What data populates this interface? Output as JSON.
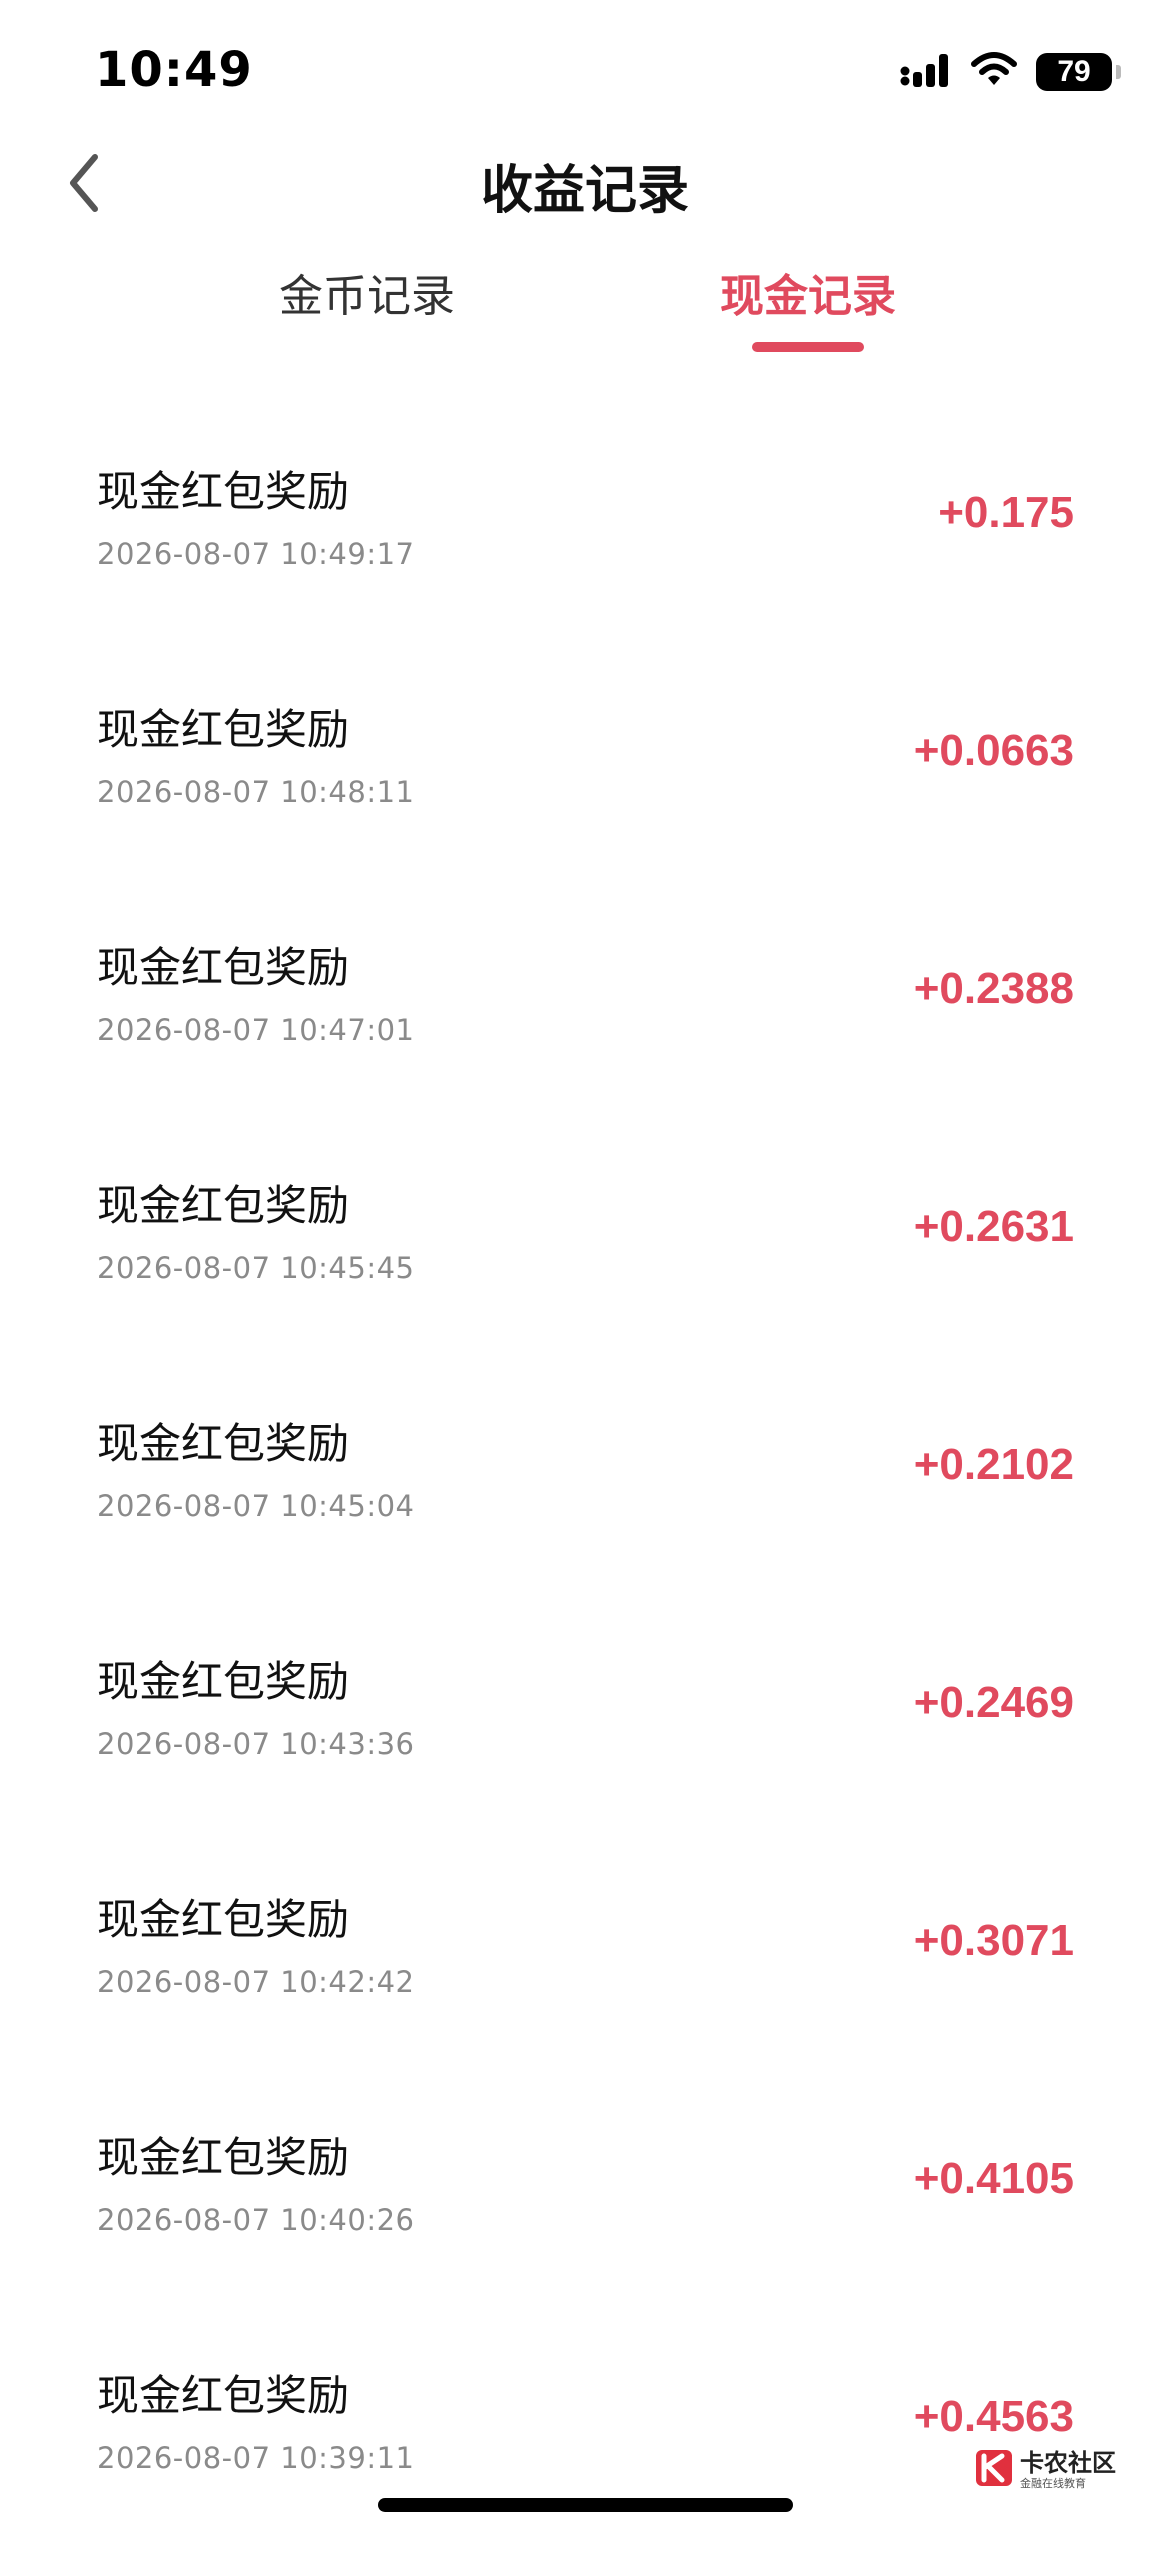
{
  "status_bar": {
    "time": "10:49",
    "battery_level": "79",
    "signal_icon": "cellular-signal-icon",
    "wifi_icon": "wifi-icon"
  },
  "header": {
    "back_icon": "chevron-left-icon",
    "title": "收益记录"
  },
  "tabs": [
    {
      "label": "金币记录",
      "active": false
    },
    {
      "label": "现金记录",
      "active": true
    }
  ],
  "records": [
    {
      "title": "现金红包奖励",
      "time": "2026-08-07 10:49:17",
      "amount": "+0.175"
    },
    {
      "title": "现金红包奖励",
      "time": "2026-08-07 10:48:11",
      "amount": "+0.0663"
    },
    {
      "title": "现金红包奖励",
      "time": "2026-08-07 10:47:01",
      "amount": "+0.2388"
    },
    {
      "title": "现金红包奖励",
      "time": "2026-08-07 10:45:45",
      "amount": "+0.2631"
    },
    {
      "title": "现金红包奖励",
      "time": "2026-08-07 10:45:04",
      "amount": "+0.2102"
    },
    {
      "title": "现金红包奖励",
      "time": "2026-08-07 10:43:36",
      "amount": "+0.2469"
    },
    {
      "title": "现金红包奖励",
      "time": "2026-08-07 10:42:42",
      "amount": "+0.3071"
    },
    {
      "title": "现金红包奖励",
      "time": "2026-08-07 10:40:26",
      "amount": "+0.4105"
    },
    {
      "title": "现金红包奖励",
      "time": "2026-08-07 10:39:11",
      "amount": "+0.4563"
    }
  ],
  "watermark": {
    "main": "卡农社区",
    "sub": "金融在线教育"
  },
  "colors": {
    "accent": "#e04a5e",
    "text_primary": "#111111",
    "text_secondary": "#8a8a8a",
    "background": "#ffffff"
  }
}
